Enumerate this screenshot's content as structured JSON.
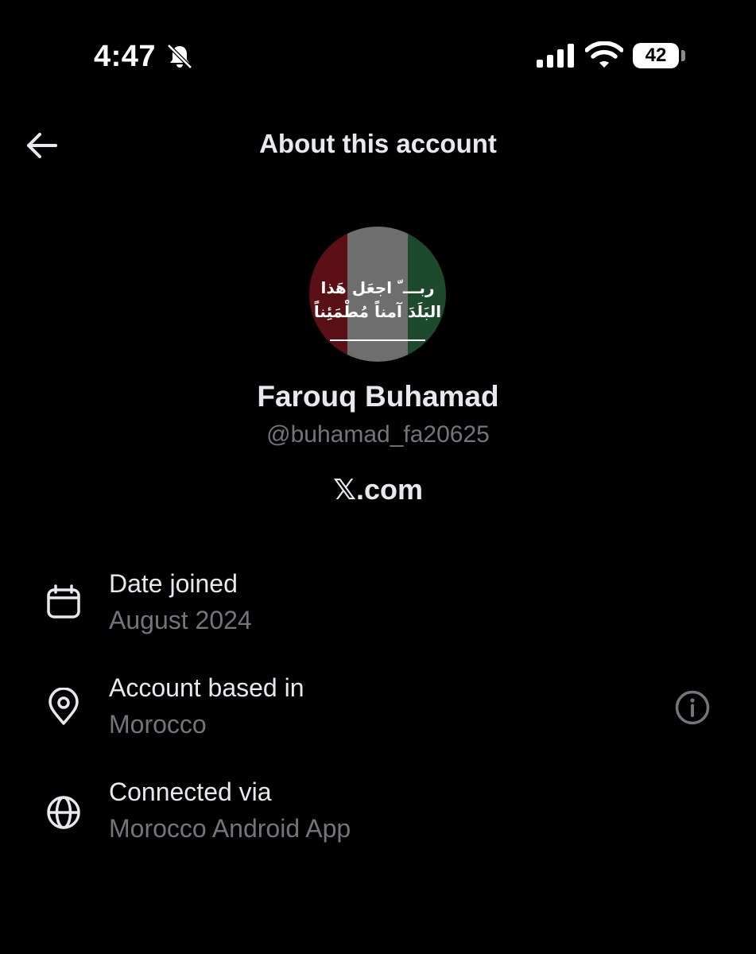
{
  "status_bar": {
    "time": "4:47",
    "battery": "42"
  },
  "header": {
    "title": "About this account"
  },
  "profile": {
    "avatar_text_line1": "ربـــ ّ اجعَل هَذا",
    "avatar_text_line2": "البَلَدَ آمناً مُطْمَئِناً",
    "display_name": "Farouq Buhamad",
    "handle": "@buhamad_fa20625",
    "site": "𝕏.com"
  },
  "info_rows": [
    {
      "icon": "calendar-icon",
      "label": "Date joined",
      "value": "August 2024"
    },
    {
      "icon": "location-pin-icon",
      "label": "Account based in",
      "value": "Morocco"
    },
    {
      "icon": "globe-icon",
      "label": "Connected via",
      "value": "Morocco Android App"
    }
  ],
  "colors": {
    "background": "#000000",
    "primary_text": "#e7e9ea",
    "secondary_text": "#71767b"
  }
}
